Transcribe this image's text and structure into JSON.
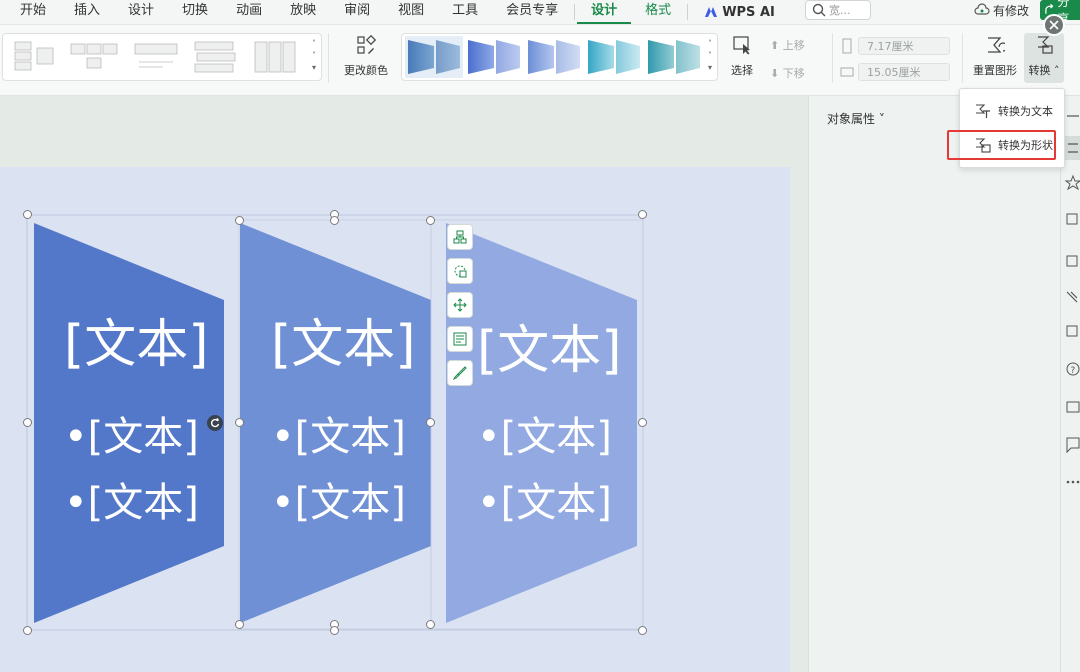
{
  "menu": {
    "items": [
      "开始",
      "插入",
      "设计",
      "切换",
      "动画",
      "放映",
      "审阅",
      "视图",
      "工具",
      "会员专享"
    ],
    "context_tabs": [
      "设计",
      "格式"
    ],
    "wps_ai": "WPS AI",
    "search_placeholder": "宽...",
    "saved_status": "有修改",
    "share": "分享"
  },
  "ribbon": {
    "change_color": "更改颜色",
    "select": "选择",
    "move_up": "上移",
    "move_down": "下移",
    "width": "7.17厘米",
    "height": "15.05厘米",
    "reset_shape": "重置图形",
    "convert": "转换"
  },
  "dropdown": {
    "to_text": "转换为文本",
    "to_shape": "转换为形状"
  },
  "panel": {
    "title": "对象属性"
  },
  "smartart": {
    "shapes": [
      {
        "heading": "[文本]",
        "bullets": [
          "•[文本]",
          "•[文本]"
        ],
        "color": "#5578c8"
      },
      {
        "heading": "[文本]",
        "bullets": [
          "•[文本]",
          "•[文本]"
        ],
        "color": "#7090d6"
      },
      {
        "heading": "[文本]",
        "bullets": [
          "•[文本]",
          "•[文本]"
        ],
        "color": "#91a9e0"
      }
    ]
  },
  "colors": {
    "accent": "#1a8a4a",
    "highlight": "#e53935",
    "slide_bg": "#dbe3f3"
  }
}
